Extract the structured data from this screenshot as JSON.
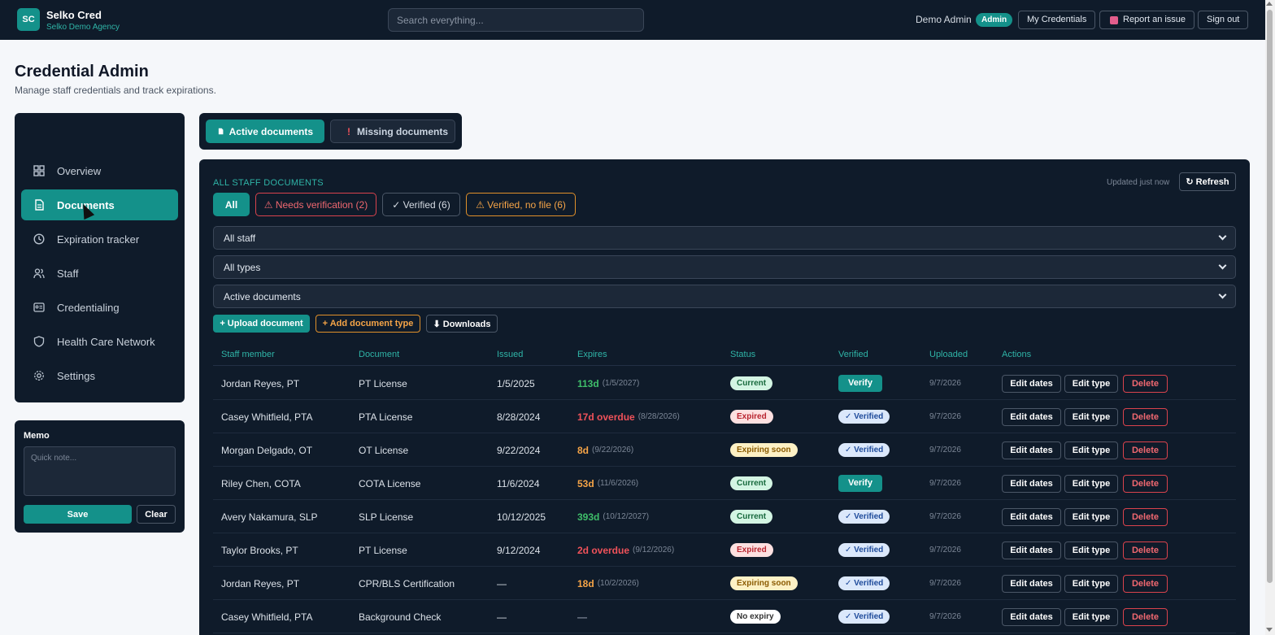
{
  "app": {
    "logo_initials": "SC",
    "name": "Selko Cred",
    "agency": "Selko Demo Agency",
    "search_placeholder": "Search everything...",
    "user_name": "Demo Admin",
    "role": "Admin",
    "my_credentials_label": "My Credentials",
    "report_issue_label": "Report an issue",
    "sign_out_label": "Sign out"
  },
  "page": {
    "title": "Credential Admin",
    "subtitle": "Manage staff credentials and track expirations."
  },
  "sidebar": {
    "items": [
      {
        "label": "Overview",
        "icon": "grid-icon"
      },
      {
        "label": "Documents",
        "icon": "document-icon",
        "active": true
      },
      {
        "label": "Expiration tracker",
        "icon": "clock-icon"
      },
      {
        "label": "Staff",
        "icon": "users-icon"
      },
      {
        "label": "Credentialing",
        "icon": "id-card-icon"
      },
      {
        "label": "Health Care Network",
        "icon": "shield-icon"
      },
      {
        "label": "Settings",
        "icon": "gear-icon"
      }
    ]
  },
  "memo": {
    "title": "Memo",
    "placeholder": "Quick note...",
    "save_label": "Save",
    "clear_label": "Clear"
  },
  "doc_tabs": {
    "active_label": "Active documents",
    "missing_label": "Missing documents"
  },
  "panel": {
    "section_label": "ALL STAFF DOCUMENTS",
    "updated_text": "Updated just now",
    "refresh_label": "↻ Refresh",
    "filters": {
      "all": "All",
      "needs_verification": "⚠ Needs verification (2)",
      "verified": "✓ Verified (6)",
      "verified_no_file": "⚠ Verified, no file (6)"
    },
    "selects": {
      "staff": "All staff",
      "types": "All types",
      "documents": "Active documents"
    },
    "actions": {
      "upload": "+ Upload document",
      "add_type": "+ Add document type",
      "downloads": "⬇ Downloads"
    },
    "columns": [
      "Staff member",
      "Document",
      "Issued",
      "Expires",
      "Status",
      "Verified",
      "Uploaded",
      "Actions"
    ],
    "row_actions": {
      "edit_dates": "Edit dates",
      "edit_type": "Edit type",
      "delete": "Delete"
    },
    "rows": [
      {
        "staff": "Jordan Reyes, PT",
        "document": "PT License",
        "issued": "1/5/2025",
        "expires_main": "113d",
        "expires_date": "(1/5/2027)",
        "expires_color": "#3fbf6a",
        "status": "Current",
        "status_class": "st-current",
        "verified": "Verify",
        "verified_type": "button",
        "uploaded": "9/7/2026"
      },
      {
        "staff": "Casey Whitfield, PTA",
        "document": "PTA License",
        "issued": "8/28/2024",
        "expires_main": "17d overdue",
        "expires_date": "(8/28/2026)",
        "expires_color": "#f0525a",
        "status": "Expired",
        "status_class": "st-expired",
        "verified": "✓ Verified",
        "verified_type": "badge",
        "uploaded": "9/7/2026"
      },
      {
        "staff": "Morgan Delgado, OT",
        "document": "OT License",
        "issued": "9/22/2024",
        "expires_main": "8d",
        "expires_date": "(9/22/2026)",
        "expires_color": "#f5a447",
        "status": "Expiring soon",
        "status_class": "st-soon",
        "verified": "✓ Verified",
        "verified_type": "badge",
        "uploaded": "9/7/2026"
      },
      {
        "staff": "Riley Chen, COTA",
        "document": "COTA License",
        "issued": "11/6/2024",
        "expires_main": "53d",
        "expires_date": "(11/6/2026)",
        "expires_color": "#f5a447",
        "status": "Current",
        "status_class": "st-current",
        "verified": "Verify",
        "verified_type": "button",
        "uploaded": "9/7/2026"
      },
      {
        "staff": "Avery Nakamura, SLP",
        "document": "SLP License",
        "issued": "10/12/2025",
        "expires_main": "393d",
        "expires_date": "(10/12/2027)",
        "expires_color": "#3fbf6a",
        "status": "Current",
        "status_class": "st-current",
        "verified": "✓ Verified",
        "verified_type": "badge",
        "uploaded": "9/7/2026"
      },
      {
        "staff": "Taylor Brooks, PT",
        "document": "PT License",
        "issued": "9/12/2024",
        "expires_main": "2d overdue",
        "expires_date": "(9/12/2026)",
        "expires_color": "#f0525a",
        "status": "Expired",
        "status_class": "st-expired",
        "verified": "✓ Verified",
        "verified_type": "badge",
        "uploaded": "9/7/2026"
      },
      {
        "staff": "Jordan Reyes, PT",
        "document": "CPR/BLS Certification",
        "issued": "—",
        "expires_main": "18d",
        "expires_date": "(10/2/2026)",
        "expires_color": "#f5a447",
        "status": "Expiring soon",
        "status_class": "st-soon",
        "verified": "✓ Verified",
        "verified_type": "badge",
        "uploaded": "9/7/2026"
      },
      {
        "staff": "Casey Whitfield, PTA",
        "document": "Background Check",
        "issued": "—",
        "expires_main": "—",
        "expires_date": "",
        "expires_color": "#7c8797",
        "status": "No expiry",
        "status_class": "st-none",
        "verified": "✓ Verified",
        "verified_type": "badge",
        "uploaded": "9/7/2026"
      }
    ]
  }
}
